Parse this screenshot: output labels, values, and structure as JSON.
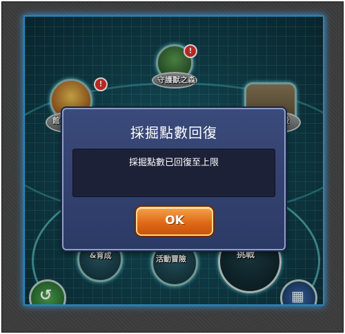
{
  "map": {
    "nodes": [
      {
        "label": "守護獸之森",
        "badge": "!"
      },
      {
        "label": "館",
        "badge": "!"
      },
      {
        "label": "殿"
      },
      {
        "label": "&育成"
      },
      {
        "label": "活動冒險"
      },
      {
        "label": "挑戰"
      }
    ]
  },
  "dialog": {
    "title": "採掘點數回復",
    "message": "採掘點數已回復至上限",
    "ok_label": "OK"
  }
}
